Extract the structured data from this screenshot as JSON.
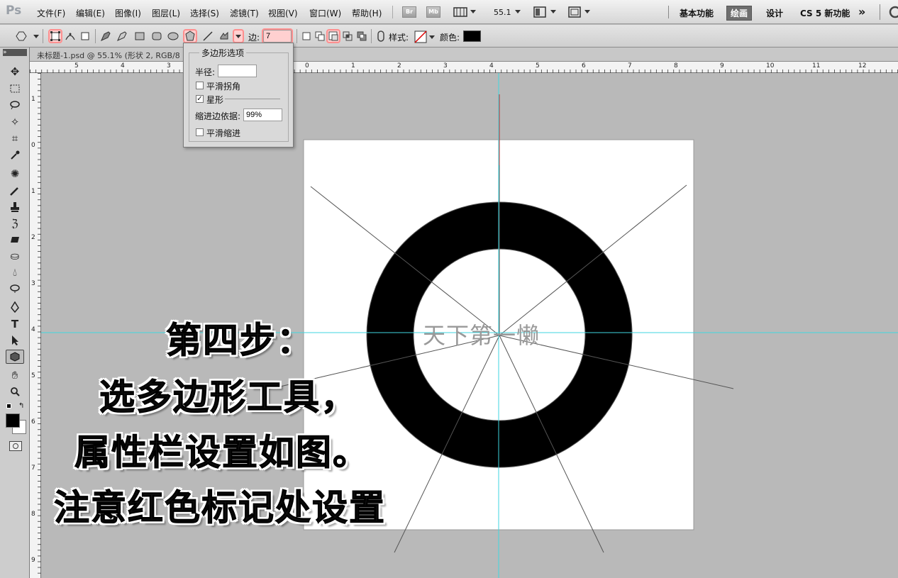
{
  "app": {
    "logo": "Ps"
  },
  "menu": [
    "文件(F)",
    "编辑(E)",
    "图像(I)",
    "图层(L)",
    "选择(S)",
    "滤镜(T)",
    "视图(V)",
    "窗口(W)",
    "帮助(H)"
  ],
  "menubar": {
    "br": "Br",
    "mb": "Mb",
    "zoom": "55.1"
  },
  "workspaces": [
    "基本功能",
    "绘画",
    "设计",
    "CS 5 新功能"
  ],
  "workspace_active": "绘画",
  "options": {
    "sides_label": "边:",
    "sides_value": "7",
    "style_label": "样式:",
    "color_label": "颜色:"
  },
  "document": {
    "title": "未标题-1.psd @ 55.1% (形状 2, RGB/8"
  },
  "ruler_top": [
    "5",
    "4",
    "3",
    "0",
    "1",
    "2",
    "3",
    "4",
    "5",
    "6",
    "7",
    "8",
    "9",
    "10",
    "11",
    "12"
  ],
  "ruler_left": [
    "1",
    "0",
    "1",
    "2",
    "3",
    "4",
    "5",
    "6",
    "7",
    "8",
    "9"
  ],
  "polygon_panel": {
    "title": "多边形选项",
    "radius_label": "半径:",
    "radius_value": "",
    "smooth_corners": "平滑拐角",
    "star": "星形",
    "star_checked": true,
    "indent_label": "缩进边依据:",
    "indent_value": "99%",
    "smooth_indent": "平滑缩进"
  },
  "canvas": {
    "watermark": "天下第一懒"
  },
  "annotation": [
    "第四步：",
    "选多边形工具，",
    "属性栏设置如图。",
    "注意红色标记处设置"
  ],
  "colors": {
    "highlight": "#ff8f8f",
    "guide": "#3fd6e0",
    "workspace_active_bg": "#6e6e6e"
  }
}
